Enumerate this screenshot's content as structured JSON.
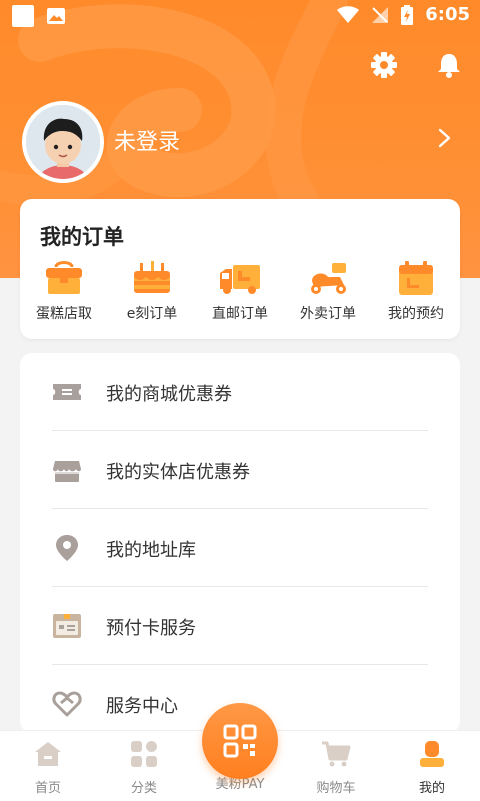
{
  "status_bar": {
    "time": "6:05"
  },
  "profile": {
    "login_text": "未登录"
  },
  "orders": {
    "title": "我的订单",
    "items": [
      {
        "label": "蛋糕店取",
        "icon": "cake-box-icon"
      },
      {
        "label": "e刻订单",
        "icon": "cake-icon"
      },
      {
        "label": "直邮订单",
        "icon": "delivery-truck-icon"
      },
      {
        "label": "外卖订单",
        "icon": "scooter-icon"
      },
      {
        "label": "我的预约",
        "icon": "calendar-icon"
      }
    ]
  },
  "services": [
    {
      "label": "我的商城优惠券",
      "icon": "ticket-icon"
    },
    {
      "label": "我的实体店优惠券",
      "icon": "store-icon"
    },
    {
      "label": "我的地址库",
      "icon": "location-pin-icon"
    },
    {
      "label": "预付卡服务",
      "icon": "prepaid-card-icon"
    },
    {
      "label": "服务中心",
      "icon": "service-heart-icon"
    }
  ],
  "bottom_nav": {
    "items": [
      {
        "label": "首页",
        "icon": "home-icon"
      },
      {
        "label": "分类",
        "icon": "category-grid-icon"
      },
      {
        "label": "美粉PAY",
        "icon": "qr-code-icon"
      },
      {
        "label": "购物车",
        "icon": "cart-icon"
      },
      {
        "label": "我的",
        "icon": "profile-icon"
      }
    ],
    "active": "我的"
  },
  "colors": {
    "accent": "#ff8a2a",
    "icon_gray": "#a9a09b",
    "text_dark": "#333333"
  }
}
